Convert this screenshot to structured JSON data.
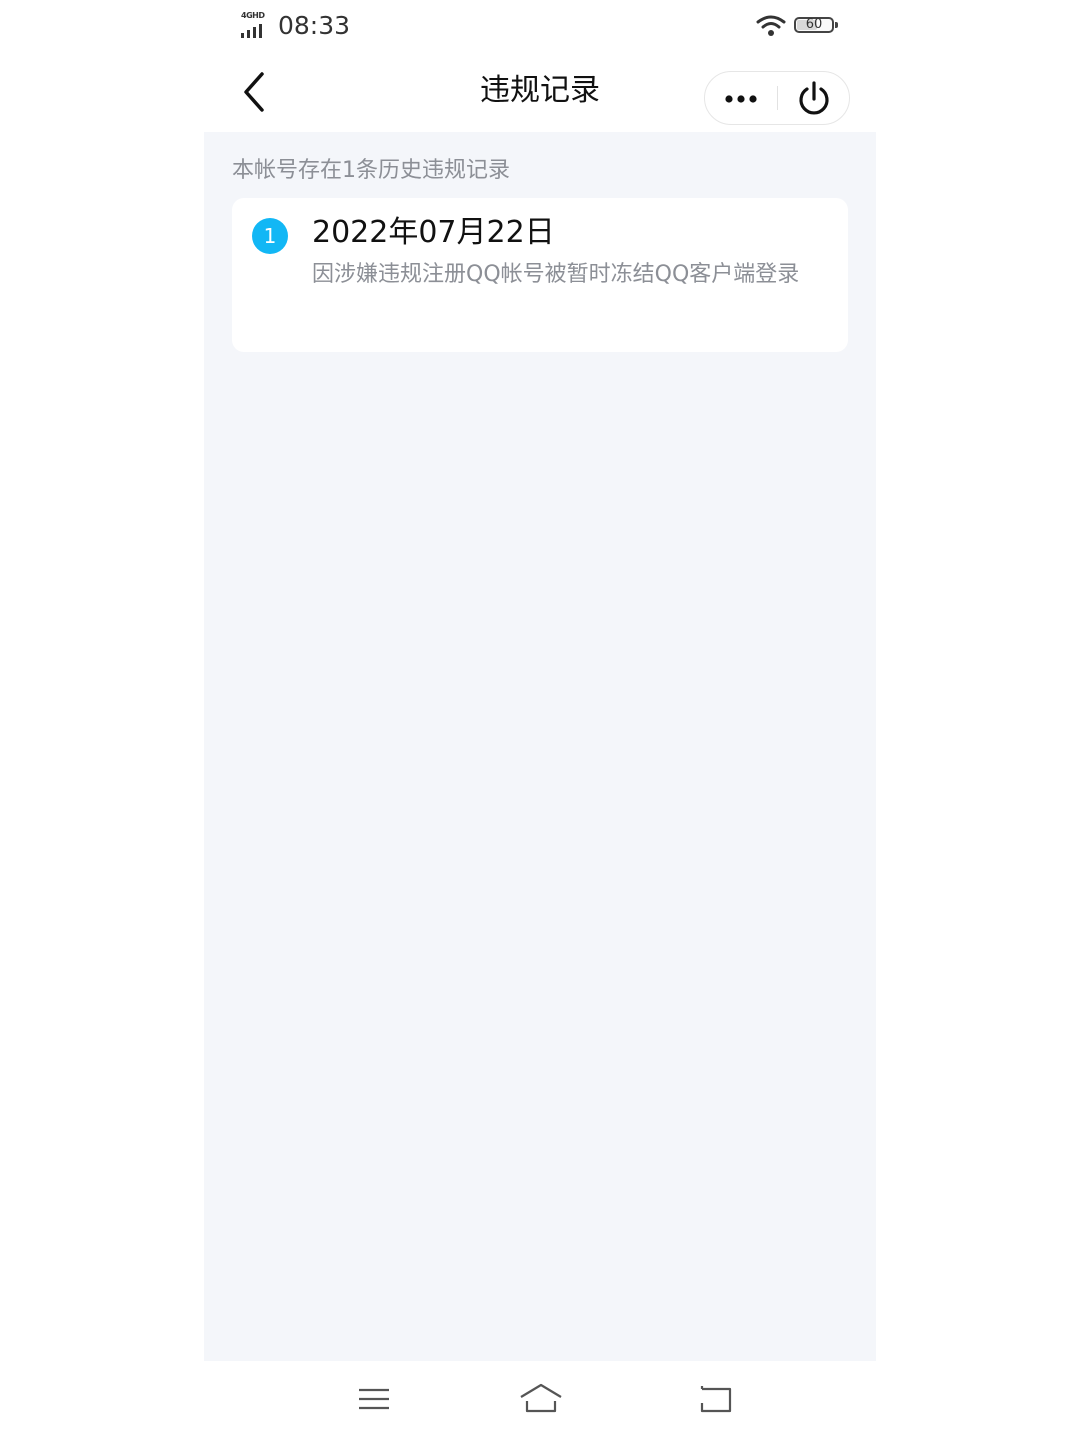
{
  "status_bar": {
    "network_label": "4GHD",
    "time": "08:33",
    "battery_level": "60",
    "battery_fraction": 0.6,
    "icons": [
      "signal-icon",
      "wifi-icon",
      "battery-icon"
    ]
  },
  "nav": {
    "title": "违规记录",
    "back_icon": "chevron-left-icon",
    "more_icon": "more-dots-icon",
    "close_icon": "power-icon"
  },
  "content": {
    "summary": "本帐号存在1条历史违规记录",
    "records": [
      {
        "index": "1",
        "date": "2022年07月22日",
        "description": "因涉嫌违规注册QQ帐号被暂时冻结QQ客户端登录"
      }
    ]
  },
  "system_nav": {
    "icons": [
      "menu-icon",
      "home-icon",
      "back-icon"
    ]
  },
  "colors": {
    "accent": "#12b7f5",
    "background": "#f4f6fa",
    "card": "#ffffff",
    "secondary_text": "#8c8f96",
    "primary_text": "#111111"
  }
}
